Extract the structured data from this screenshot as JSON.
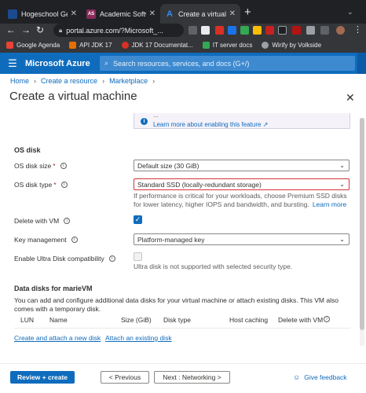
{
  "browser": {
    "tabs": [
      {
        "title": "Hogeschool Gent",
        "favicon_color": "#1b4a8f",
        "favicon_text": "",
        "active": false
      },
      {
        "title": "Academic Softwa",
        "favicon_color": "#8a2b5a",
        "favicon_text": "AS",
        "active": false
      },
      {
        "title": "Create a virtual m",
        "favicon_color": "#0078d4",
        "favicon_text": "A",
        "active": true
      }
    ],
    "new_tab": "+",
    "address": "portal.azure.com/?Microsoft_...",
    "bookmarks": [
      {
        "label": "Google Agenda",
        "color": "#ea4335"
      },
      {
        "label": "API JDK 17",
        "color": "#e76f00"
      },
      {
        "label": "JDK 17 Documentat...",
        "color": "#d93025"
      },
      {
        "label": "IT server docs",
        "color": "#34a853"
      },
      {
        "label": "Wirify by Volkside",
        "color": "#9aa0a6"
      }
    ]
  },
  "azure": {
    "brand": "Microsoft Azure",
    "search_placeholder": "Search resources, services, and docs (G+/)",
    "breadcrumb": [
      "Home",
      "Create a resource",
      "Marketplace"
    ],
    "page_title": "Create a virtual machine",
    "info_banner": {
      "text_partial": "...",
      "link": "Learn more about enabling this feature"
    },
    "os_disk": {
      "heading": "OS disk",
      "size_label": "OS disk size",
      "size_value": "Default size (30 GiB)",
      "type_label": "OS disk type",
      "type_value": "Standard SSD (locally-redundant storage)",
      "type_help": "If performance is critical for your workloads, choose Premium SSD disks for lower latency, higher IOPS and bandwidth, and bursting.",
      "learn_more": "Learn more",
      "delete_label": "Delete with VM",
      "delete_checked": true,
      "key_label": "Key management",
      "key_value": "Platform-managed key",
      "ultra_label": "Enable Ultra Disk compatibility",
      "ultra_checked": false,
      "ultra_help": "Ultra disk is not supported with selected security type."
    },
    "data_disks": {
      "heading": "Data disks for marieVM",
      "description": "You can add and configure additional data disks for your virtual machine or attach existing disks. This VM also comes with a temporary disk.",
      "columns": [
        "LUN",
        "Name",
        "Size (GiB)",
        "Disk type",
        "Host caching",
        "Delete with VM"
      ],
      "create_link": "Create and attach a new disk",
      "attach_link": "Attach an existing disk"
    },
    "footer": {
      "review": "Review + create",
      "previous": "< Previous",
      "next": "Next : Networking >",
      "feedback": "Give feedback"
    }
  }
}
